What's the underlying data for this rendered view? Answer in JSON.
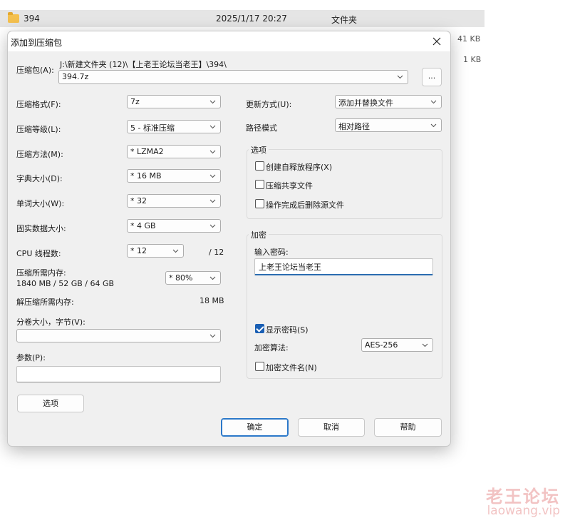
{
  "explorer": {
    "row": {
      "name": "394",
      "date": "2025/1/17 20:27",
      "type": "文件夹"
    },
    "size1": "41 KB",
    "size2": "1 KB"
  },
  "dialog": {
    "title": "添加到压缩包",
    "archive_label": "压缩包(A):",
    "archive_path": "J:\\新建文件夹 (12)\\【上老王论坛当老王】\\394\\",
    "archive_name": "394.7z",
    "browse_label": "...",
    "left": {
      "format": {
        "label": "压缩格式(F):",
        "value": "7z"
      },
      "level": {
        "label": "压缩等级(L):",
        "value": "5 - 标准压缩"
      },
      "method": {
        "label": "压缩方法(M):",
        "value": "* LZMA2"
      },
      "dict": {
        "label": "字典大小(D):",
        "value": "* 16 MB"
      },
      "word": {
        "label": "单词大小(W):",
        "value": "* 32"
      },
      "solid": {
        "label": "固实数据大小:",
        "value": "* 4 GB"
      },
      "cpu": {
        "label": "CPU 线程数:",
        "value": "* 12",
        "max": "/ 12"
      },
      "mem_compress": {
        "label": "压缩所需内存:",
        "detail": "1840 MB / 52 GB / 64 GB",
        "value": "* 80%"
      },
      "mem_decompress": {
        "label": "解压缩所需内存:",
        "value": "18 MB"
      },
      "volume": {
        "label": "分卷大小，字节(V):",
        "value": ""
      },
      "params": {
        "label": "参数(P):",
        "value": ""
      },
      "options_button": "选项"
    },
    "right": {
      "update": {
        "label": "更新方式(U):",
        "value": "添加并替换文件"
      },
      "path": {
        "label": "路径模式",
        "value": "相对路径"
      },
      "options": {
        "title": "选项",
        "sfx": "创建自释放程序(X)",
        "shared": "压缩共享文件",
        "delete": "操作完成后删除源文件"
      },
      "encryption": {
        "title": "加密",
        "password_label": "输入密码:",
        "password": "上老王论坛当老王",
        "show_password": "显示密码(S)",
        "method_label": "加密算法:",
        "method": "AES-256",
        "encrypt_names": "加密文件名(N)"
      }
    },
    "buttons": {
      "ok": "确定",
      "cancel": "取消",
      "help": "帮助"
    }
  },
  "watermark": {
    "cn": "老王论坛",
    "url": "laowang.vip"
  }
}
